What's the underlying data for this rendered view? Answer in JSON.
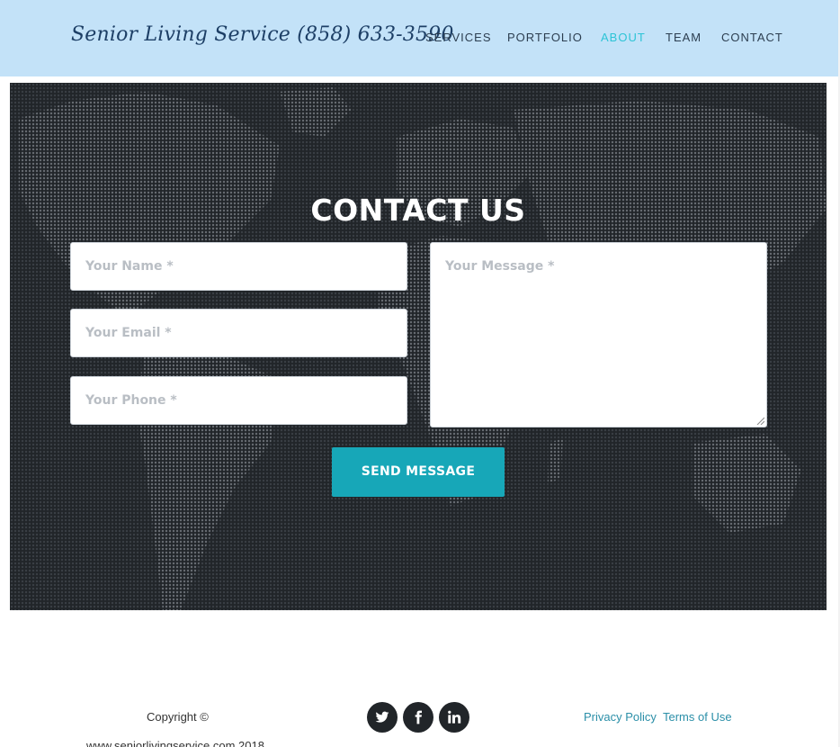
{
  "navbar": {
    "brand": "Senior Living Service (858) 633-3590",
    "links": [
      {
        "label": "SERVICES",
        "active": false
      },
      {
        "label": "PORTFOLIO",
        "active": false
      },
      {
        "label": "ABOUT",
        "active": true
      },
      {
        "label": "TEAM",
        "active": false
      },
      {
        "label": "CONTACT",
        "active": false
      }
    ]
  },
  "contact": {
    "title": "CONTACT US",
    "fields": {
      "name_placeholder": "Your Name *",
      "email_placeholder": "Your Email *",
      "phone_placeholder": "Your Phone *",
      "message_placeholder": "Your Message *"
    },
    "send_label": "SEND MESSAGE"
  },
  "footer": {
    "copyright": "Copyright ©",
    "site": "www.seniorlivingservice.com 2018",
    "social": [
      {
        "icon": "twitter-icon"
      },
      {
        "icon": "facebook-icon"
      },
      {
        "icon": "linkedin-icon"
      }
    ],
    "links": [
      "Privacy Policy",
      "Terms of Use"
    ]
  },
  "colors": {
    "navbar_bg": "#c3e2f8",
    "brand": "#1d3f66",
    "active_link": "#2cc4d6",
    "section_bg": "#212529",
    "button": "#17a7b8",
    "footer_link": "#2b8fa8"
  }
}
